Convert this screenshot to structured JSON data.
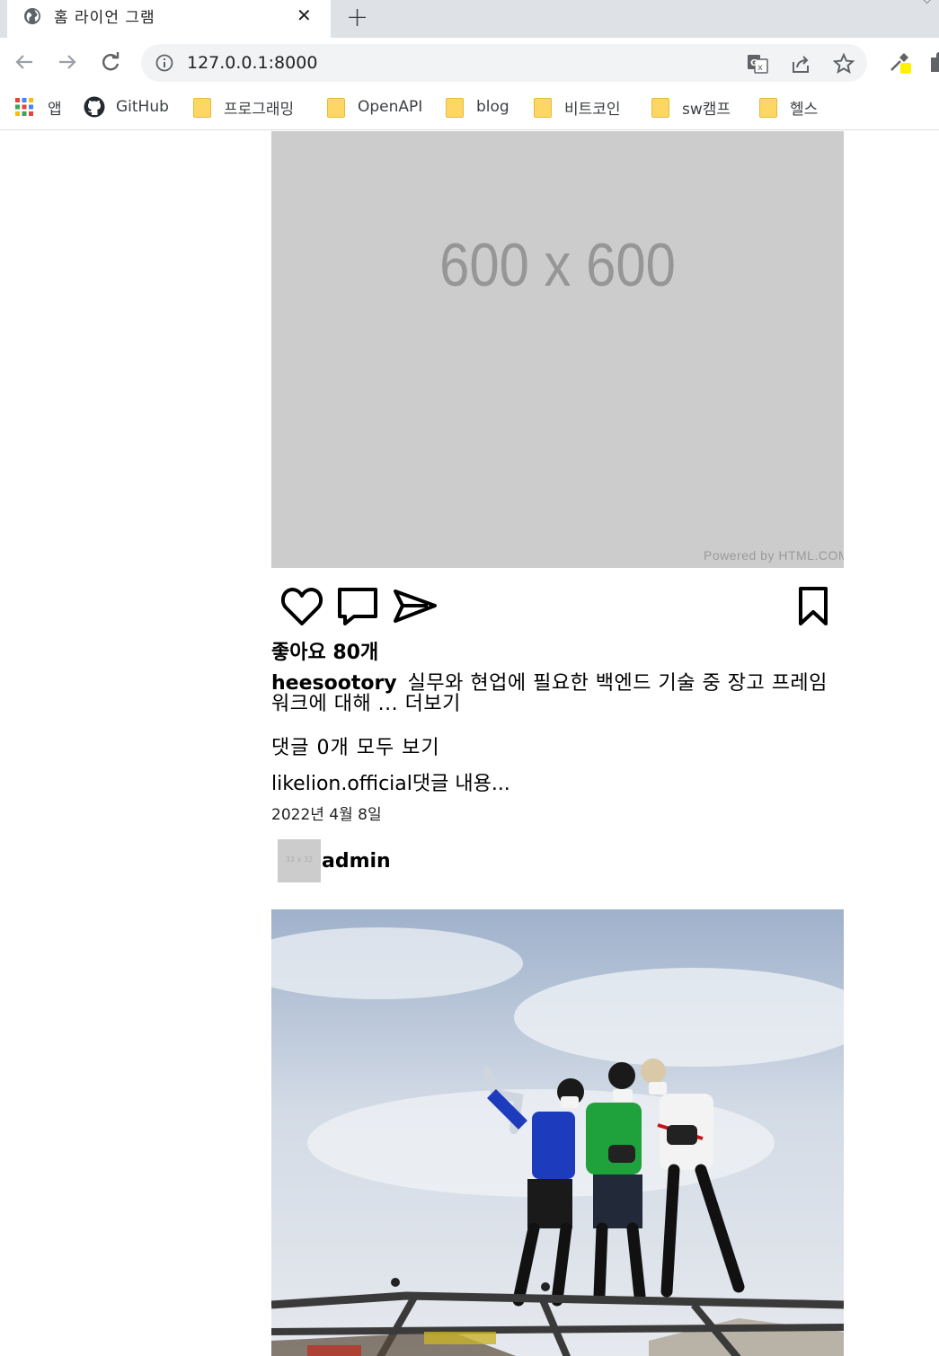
{
  "browser": {
    "tab_title": "홈 라이언 그램",
    "tab_close": "✕",
    "new_tab": "+",
    "url": "127.0.0.1:8000",
    "bookmarks": [
      {
        "label": "앱",
        "icon": "apps-grid-icon"
      },
      {
        "label": "GitHub",
        "icon": "github-icon"
      },
      {
        "label": "프로그래밍",
        "icon": "folder-icon"
      },
      {
        "label": "OpenAPI",
        "icon": "folder-icon"
      },
      {
        "label": "blog",
        "icon": "folder-icon"
      },
      {
        "label": "비트코인",
        "icon": "folder-icon"
      },
      {
        "label": "sw캠프",
        "icon": "folder-icon"
      },
      {
        "label": "헬스",
        "icon": "folder-icon"
      }
    ]
  },
  "post1": {
    "placeholder_text": "600 x 600",
    "placeholder_powered": "Powered by HTML.COM",
    "likes": "좋아요 80개",
    "author": "heesootory",
    "caption": "실무와 현업에 필요한 백엔드 기술 중 장고 프레임워크에 대해 ... 더보기",
    "comments_link": "댓글 0개 모두 보기",
    "comment": "likelion.official댓글 내용...",
    "date": "2022년 4월 8일"
  },
  "post2": {
    "avatar_text": "32 x 32",
    "author": "admin"
  },
  "colors": {
    "tabstrip": "#dee1e6",
    "placeholder_bg": "#cccccc",
    "folder": "#fdd663",
    "sky": "#c9d3e2"
  }
}
